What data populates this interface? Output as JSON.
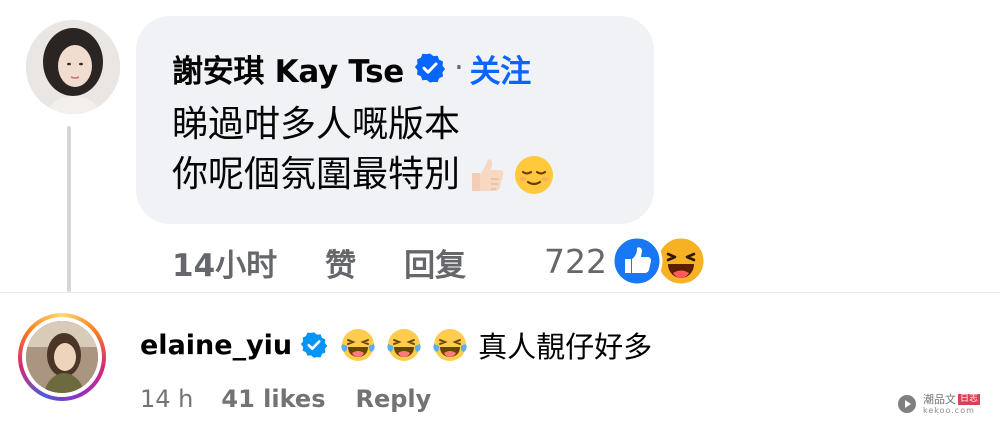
{
  "fb_comment": {
    "author": "謝安琪 Kay Tse",
    "separator": "·",
    "follow_label": "关注",
    "text_lines": [
      "睇過咁多人嘅版本",
      "你呢個氛圍最特別"
    ],
    "trailing_emojis": [
      "thumbs-up",
      "relieved-face"
    ],
    "actions": {
      "time": "14小时",
      "like_label": "赞",
      "reply_label": "回复"
    },
    "reactions": {
      "count": "722",
      "types": [
        "like",
        "haha"
      ],
      "colors": {
        "like": "#1877f2",
        "haha": "#f7b125"
      }
    },
    "bubble_color": "#f0f2f5",
    "link_color": "#0866ff"
  },
  "ig_comment": {
    "username": "elaine_yiu",
    "verified": true,
    "emojis": [
      "laughing-tears",
      "laughing-tears",
      "laughing-tears"
    ],
    "text": "真人靚仔好多",
    "actions": {
      "time": "14 h",
      "likes": "41 likes",
      "reply_label": "Reply"
    },
    "avatar_ring_colors": [
      "#feda75",
      "#fa7e1e",
      "#d62976",
      "#962fbf",
      "#4f5bd5"
    ]
  },
  "watermark": {
    "cn_text": "潮品文",
    "cn_badge": "日志",
    "en_text": "kekoo.com"
  }
}
